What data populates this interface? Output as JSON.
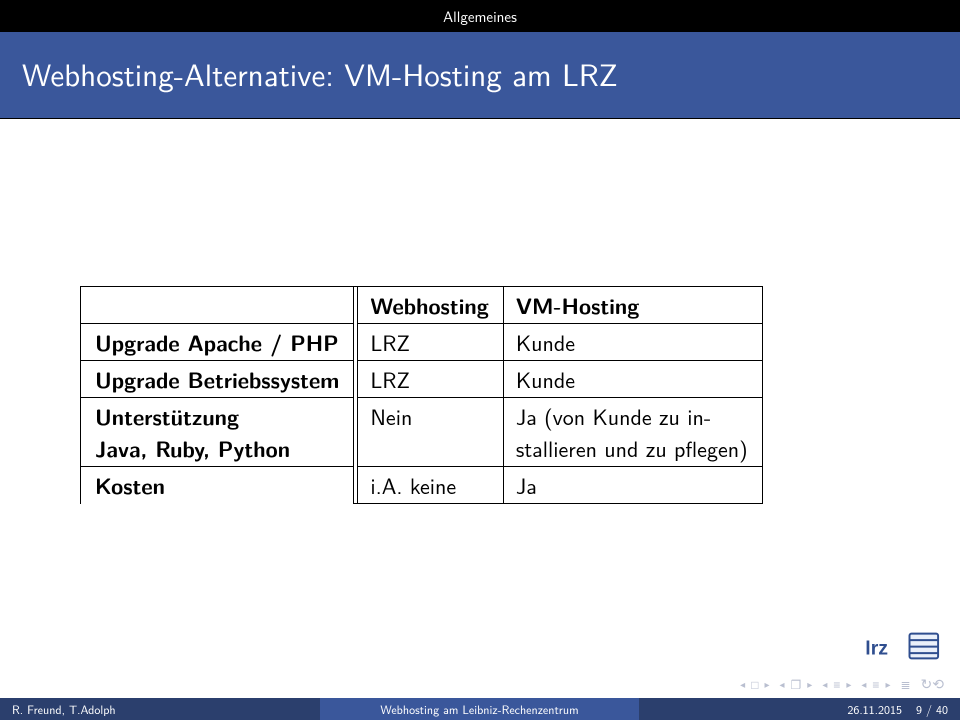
{
  "header": {
    "section": "Allgemeines",
    "title": "Webhosting-Alternative: VM-Hosting am LRZ"
  },
  "table": {
    "head": {
      "c1": "Webhosting",
      "c2": "VM-Hosting"
    },
    "rows": [
      {
        "a": "Upgrade Apache / PHP",
        "b": "LRZ",
        "c": "Kunde"
      },
      {
        "a": "Upgrade Betriebssystem",
        "b": "LRZ",
        "c": "Kunde"
      },
      {
        "a": "Unterstützung Java, Ruby, Python",
        "b": "Nein",
        "c": "Ja (von Kunde zu installieren und zu pflegen)"
      },
      {
        "a": "Kosten",
        "b": "i.A. keine",
        "c": "Ja"
      }
    ],
    "row3": {
      "a_line1": "Unterstützung",
      "a_line2": "Java, Ruby, Python",
      "b": "Nein",
      "c_line1": "Ja (von Kunde zu in-",
      "c_line2": "stallieren und zu pflegen)"
    }
  },
  "footer": {
    "authors": "R. Freund, T.Adolph",
    "center": "Webhosting am Leibniz-Rechenzentrum",
    "date": "26.11.2015",
    "page": "9 / 40"
  },
  "chart_data": {
    "type": "table",
    "title": "Webhosting-Alternative: VM-Hosting am LRZ",
    "columns": [
      "",
      "Webhosting",
      "VM-Hosting"
    ],
    "rows": [
      [
        "Upgrade Apache / PHP",
        "LRZ",
        "Kunde"
      ],
      [
        "Upgrade Betriebssystem",
        "LRZ",
        "Kunde"
      ],
      [
        "Unterstützung Java, Ruby, Python",
        "Nein",
        "Ja (von Kunde zu installieren und zu pflegen)"
      ],
      [
        "Kosten",
        "i.A. keine",
        "Ja"
      ]
    ]
  }
}
